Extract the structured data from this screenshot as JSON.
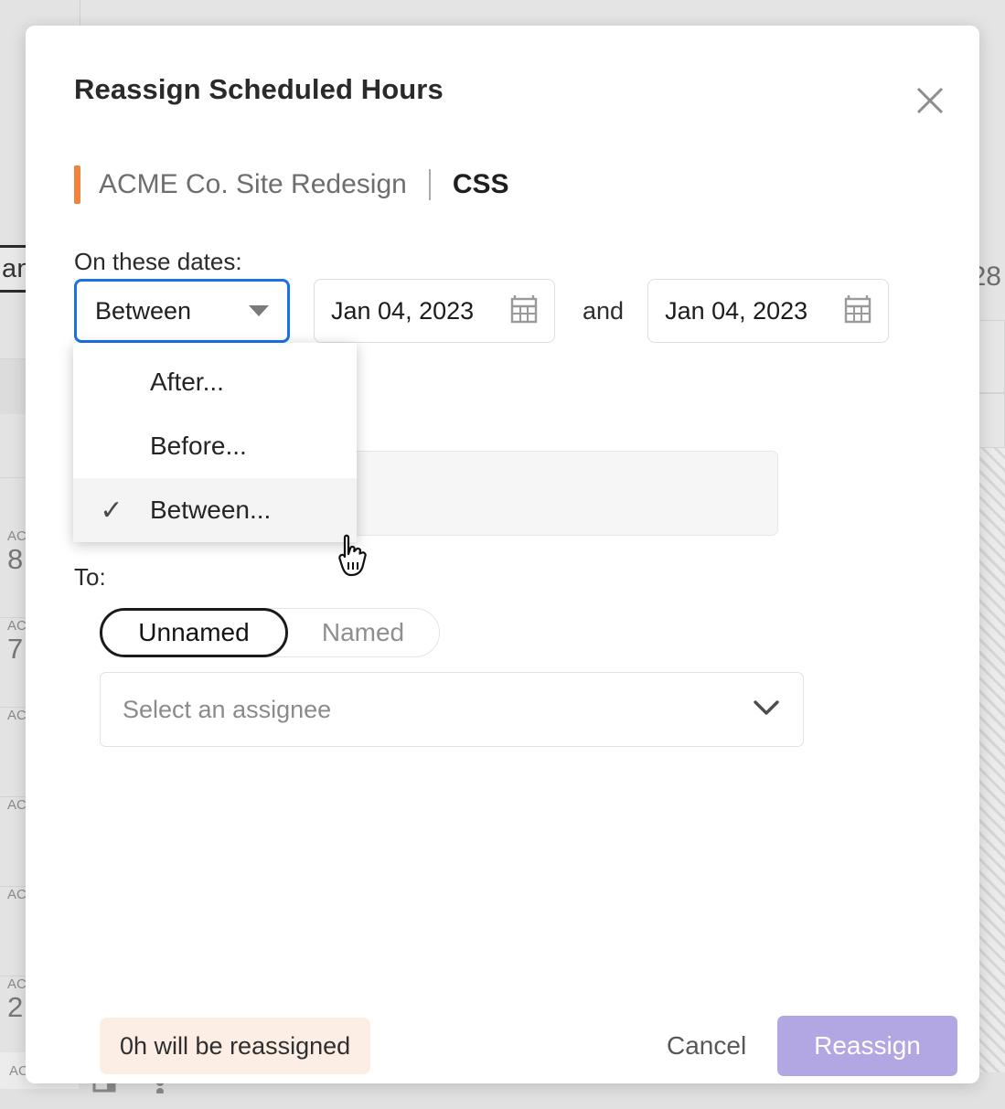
{
  "modal": {
    "title": "Reassign Scheduled Hours",
    "close_icon": "close-icon",
    "project_name": "ACME Co. Site Redesign",
    "subtitle_separator": "|",
    "task_name": "CSS",
    "accent_color": "#f2823c",
    "dates_label": "On these dates:",
    "to_label": "To:",
    "range_select": {
      "value": "Between",
      "caret_icon": "chevron-down-icon",
      "focus_color": "#1b72e8",
      "options": [
        {
          "label": "After...",
          "selected": false
        },
        {
          "label": "Before...",
          "selected": false
        },
        {
          "label": "Between...",
          "selected": true,
          "check_icon": "check-icon"
        }
      ]
    },
    "date_start": {
      "value": "Jan 04, 2023",
      "icon": "calendar-icon"
    },
    "and_label": "and",
    "date_end": {
      "value": "Jan 04, 2023",
      "icon": "calendar-icon"
    },
    "assignee_toggle": {
      "options": [
        {
          "label": "Unnamed",
          "active": true
        },
        {
          "label": "Named",
          "active": false
        }
      ]
    },
    "assignee_select": {
      "placeholder": "Select an assignee",
      "value": "",
      "chevron_icon": "chevron-down-icon"
    },
    "footer": {
      "status_text": "0h will be reassigned",
      "status_bg": "#fceee4",
      "cancel_label": "Cancel",
      "reassign_label": "Reassign",
      "reassign_bg": "#b3a7e3"
    }
  },
  "background": {
    "left_header_text": "an",
    "right_number": "28",
    "rows": [
      {
        "code": "AC",
        "num": "8"
      },
      {
        "code": "AC",
        "num": "7"
      },
      {
        "code": "AC",
        "num": ""
      },
      {
        "code": "AC",
        "num": ""
      },
      {
        "code": "AC",
        "num": ""
      },
      {
        "code": "AC",
        "num": "2"
      }
    ],
    "bottom_tab_label": "ACT",
    "toolbar_icons": [
      "panel-icon",
      "more-vertical-icon"
    ]
  },
  "cursor": {
    "type": "pointing-hand-cursor"
  }
}
